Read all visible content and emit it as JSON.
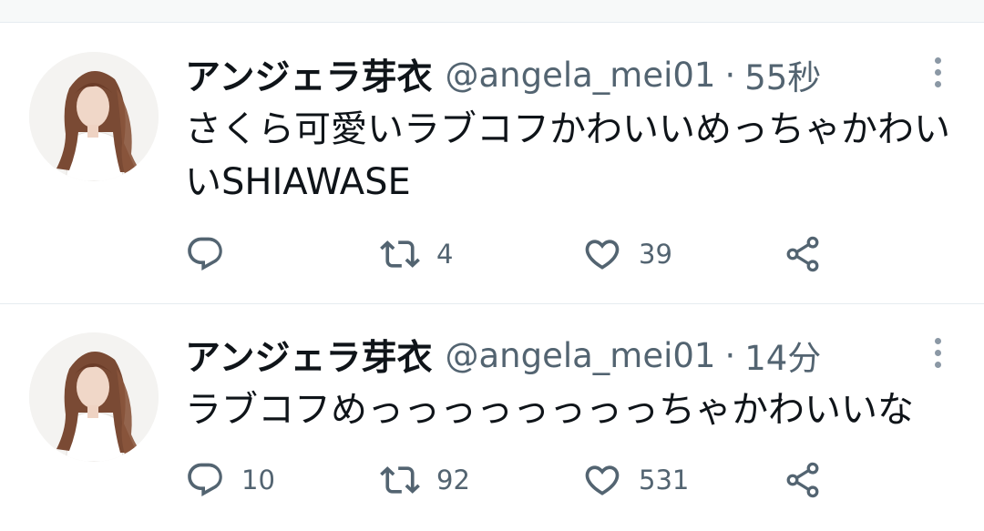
{
  "tweets": [
    {
      "display_name": "アンジェラ芽衣",
      "handle": "@angela_mei01",
      "separator": "·",
      "time": "55秒",
      "text": "さくら可愛いラブコフかわいいめっちゃかわいいSHIAWASE",
      "replies": "",
      "retweets": "4",
      "likes": "39"
    },
    {
      "display_name": "アンジェラ芽衣",
      "handle": "@angela_mei01",
      "separator": "·",
      "time": "14分",
      "text": "ラブコフめっっっっっっっっちゃかわいいな",
      "replies": "10",
      "retweets": "92",
      "likes": "531"
    }
  ],
  "icons": {
    "reply": "reply-icon",
    "retweet": "retweet-icon",
    "like": "heart-icon",
    "share": "share-icon",
    "more": "more-icon"
  },
  "colors": {
    "text": "#0f1419",
    "secondary": "#536471",
    "divider": "#e6ecf0"
  }
}
